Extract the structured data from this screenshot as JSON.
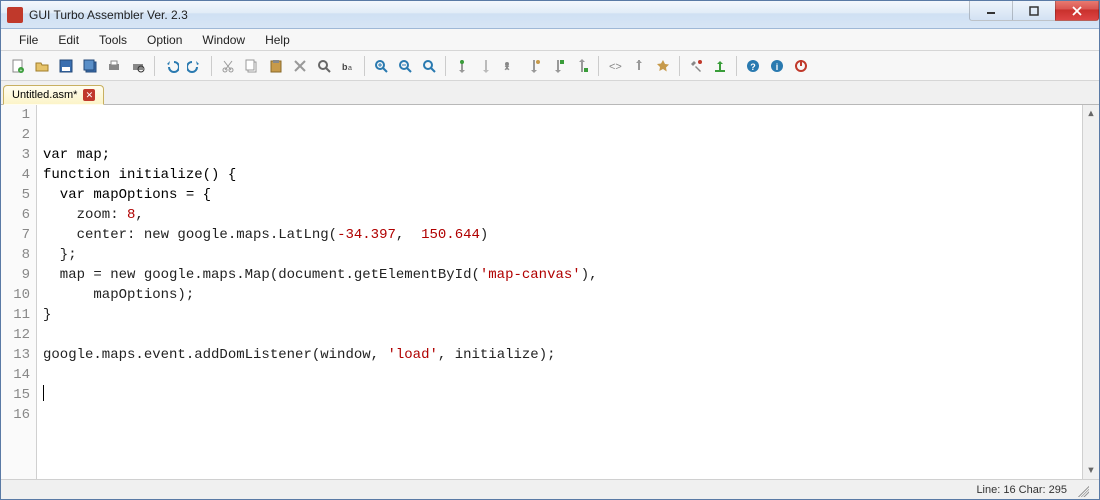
{
  "window": {
    "title": "GUI Turbo Assembler Ver. 2.3"
  },
  "menubar": {
    "items": [
      "File",
      "Edit",
      "Tools",
      "Option",
      "Window",
      "Help"
    ]
  },
  "toolbar_icons": [
    "new-file",
    "open-file",
    "save",
    "save-all",
    "print",
    "print-preview",
    "sep",
    "undo",
    "redo",
    "sep",
    "cut",
    "copy",
    "paste",
    "delete",
    "find",
    "find-text",
    "sep",
    "zoom-in",
    "zoom-out",
    "zoom-reset",
    "sep",
    "toggle-breakpoint",
    "clear-breakpoints",
    "run",
    "step-over",
    "step-into",
    "step-out",
    "sep",
    "go-back",
    "go-forward",
    "bookmark",
    "sep",
    "build",
    "upload",
    "sep",
    "help",
    "info",
    "power"
  ],
  "tabs": [
    {
      "label": "Untitled.asm*",
      "active": true
    }
  ],
  "editor": {
    "line_count": 16,
    "lines": [
      {
        "tokens": []
      },
      {
        "tokens": []
      },
      {
        "tokens": [
          {
            "t": "var map;",
            "c": "kw"
          }
        ]
      },
      {
        "tokens": [
          {
            "t": "function initialize() {",
            "c": "kw"
          }
        ]
      },
      {
        "tokens": [
          {
            "t": "  var mapOptions = {",
            "c": "kw"
          }
        ]
      },
      {
        "tokens": [
          {
            "t": "    zoom: ",
            "c": ""
          },
          {
            "t": "8",
            "c": "num"
          },
          {
            "t": ",",
            "c": ""
          }
        ]
      },
      {
        "tokens": [
          {
            "t": "    center: new google.maps.LatLng(",
            "c": ""
          },
          {
            "t": "-34.397",
            "c": "num"
          },
          {
            "t": ",  ",
            "c": ""
          },
          {
            "t": "150.644",
            "c": "num"
          },
          {
            "t": ")",
            "c": ""
          }
        ]
      },
      {
        "tokens": [
          {
            "t": "  };",
            "c": ""
          }
        ]
      },
      {
        "tokens": [
          {
            "t": "  map = new google.maps.Map(document.getElementById(",
            "c": ""
          },
          {
            "t": "'map-canvas'",
            "c": "str"
          },
          {
            "t": "),",
            "c": ""
          }
        ]
      },
      {
        "tokens": [
          {
            "t": "      mapOptions);",
            "c": ""
          }
        ]
      },
      {
        "tokens": [
          {
            "t": "}",
            "c": ""
          }
        ]
      },
      {
        "tokens": []
      },
      {
        "tokens": [
          {
            "t": "google.maps.event.addDomListener(window, ",
            "c": ""
          },
          {
            "t": "'load'",
            "c": "str"
          },
          {
            "t": ", initialize);",
            "c": ""
          }
        ]
      },
      {
        "tokens": []
      },
      {
        "tokens": [],
        "cursor": true
      },
      {
        "tokens": []
      }
    ]
  },
  "status": {
    "line_label": "Line:",
    "line": 16,
    "char_label": "Char:",
    "char": 295
  },
  "colors": {
    "accent_red": "#c0392b",
    "toolbar_blue": "#2a7ab0",
    "toolbar_green": "#3a9d3a"
  }
}
